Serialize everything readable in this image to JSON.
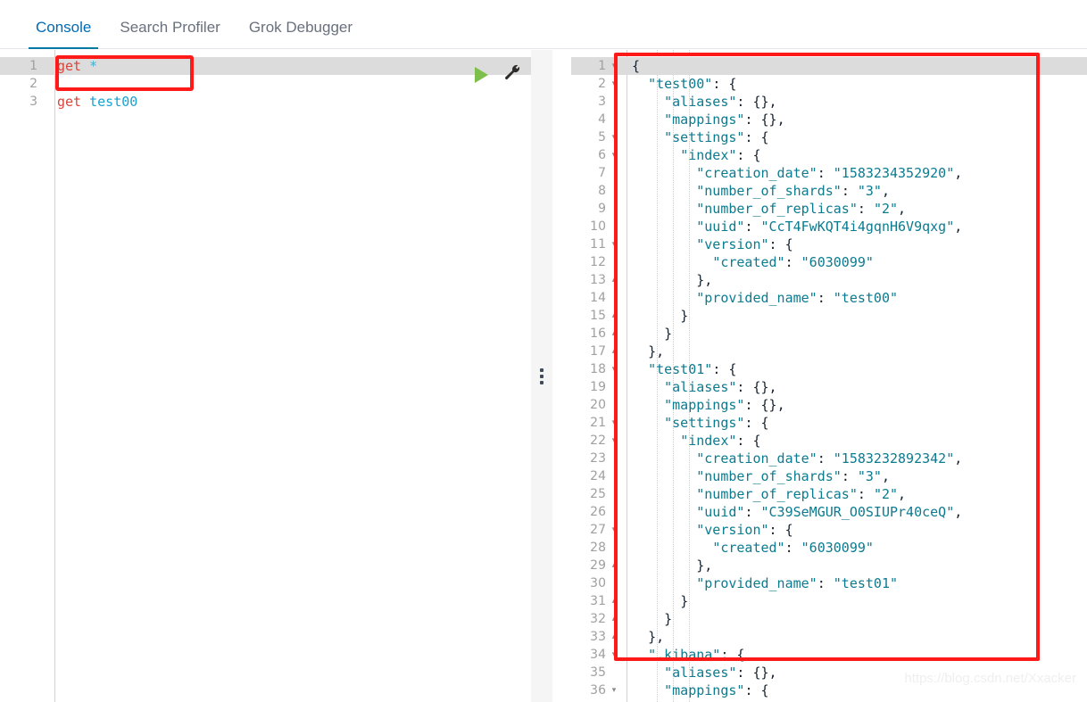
{
  "tabs": [
    {
      "label": "Console",
      "active": true
    },
    {
      "label": "Search Profiler",
      "active": false
    },
    {
      "label": "Grok Debugger",
      "active": false
    }
  ],
  "editor": {
    "error_marker": "error-icon",
    "run_button_label": "play-icon",
    "settings_button_label": "wrench-icon",
    "lines": [
      {
        "num": "1",
        "highlight": true,
        "tokens": [
          {
            "t": "get",
            "c": "kw-get"
          },
          {
            "t": " ",
            "c": ""
          },
          {
            "t": "*",
            "c": "kw-star"
          }
        ]
      },
      {
        "num": "2",
        "highlight": false,
        "tokens": []
      },
      {
        "num": "3",
        "highlight": false,
        "tokens": [
          {
            "t": "get",
            "c": "kw-get"
          },
          {
            "t": " ",
            "c": ""
          },
          {
            "t": "test00",
            "c": "kw-url"
          }
        ]
      }
    ]
  },
  "output": {
    "lines": [
      {
        "num": "1",
        "fold": "▾",
        "highlight": true,
        "text": "{"
      },
      {
        "num": "2",
        "fold": "▾",
        "highlight": false,
        "text": "  \"test00\": {"
      },
      {
        "num": "3",
        "fold": "",
        "highlight": false,
        "text": "    \"aliases\": {},"
      },
      {
        "num": "4",
        "fold": "",
        "highlight": false,
        "text": "    \"mappings\": {},"
      },
      {
        "num": "5",
        "fold": "▾",
        "highlight": false,
        "text": "    \"settings\": {"
      },
      {
        "num": "6",
        "fold": "▾",
        "highlight": false,
        "text": "      \"index\": {"
      },
      {
        "num": "7",
        "fold": "",
        "highlight": false,
        "text": "        \"creation_date\": \"1583234352920\","
      },
      {
        "num": "8",
        "fold": "",
        "highlight": false,
        "text": "        \"number_of_shards\": \"3\","
      },
      {
        "num": "9",
        "fold": "",
        "highlight": false,
        "text": "        \"number_of_replicas\": \"2\","
      },
      {
        "num": "10",
        "fold": "",
        "highlight": false,
        "text": "        \"uuid\": \"CcT4FwKQT4i4gqnH6V9qxg\","
      },
      {
        "num": "11",
        "fold": "▾",
        "highlight": false,
        "text": "        \"version\": {"
      },
      {
        "num": "12",
        "fold": "",
        "highlight": false,
        "text": "          \"created\": \"6030099\""
      },
      {
        "num": "13",
        "fold": "▴",
        "highlight": false,
        "text": "        },"
      },
      {
        "num": "14",
        "fold": "",
        "highlight": false,
        "text": "        \"provided_name\": \"test00\""
      },
      {
        "num": "15",
        "fold": "▴",
        "highlight": false,
        "text": "      }"
      },
      {
        "num": "16",
        "fold": "▴",
        "highlight": false,
        "text": "    }"
      },
      {
        "num": "17",
        "fold": "▴",
        "highlight": false,
        "text": "  },"
      },
      {
        "num": "18",
        "fold": "▾",
        "highlight": false,
        "text": "  \"test01\": {"
      },
      {
        "num": "19",
        "fold": "",
        "highlight": false,
        "text": "    \"aliases\": {},"
      },
      {
        "num": "20",
        "fold": "",
        "highlight": false,
        "text": "    \"mappings\": {},"
      },
      {
        "num": "21",
        "fold": "▾",
        "highlight": false,
        "text": "    \"settings\": {"
      },
      {
        "num": "22",
        "fold": "▾",
        "highlight": false,
        "text": "      \"index\": {"
      },
      {
        "num": "23",
        "fold": "",
        "highlight": false,
        "text": "        \"creation_date\": \"1583232892342\","
      },
      {
        "num": "24",
        "fold": "",
        "highlight": false,
        "text": "        \"number_of_shards\": \"3\","
      },
      {
        "num": "25",
        "fold": "",
        "highlight": false,
        "text": "        \"number_of_replicas\": \"2\","
      },
      {
        "num": "26",
        "fold": "",
        "highlight": false,
        "text": "        \"uuid\": \"C39SeMGUR_O0SIUPr40ceQ\","
      },
      {
        "num": "27",
        "fold": "▾",
        "highlight": false,
        "text": "        \"version\": {"
      },
      {
        "num": "28",
        "fold": "",
        "highlight": false,
        "text": "          \"created\": \"6030099\""
      },
      {
        "num": "29",
        "fold": "▴",
        "highlight": false,
        "text": "        },"
      },
      {
        "num": "30",
        "fold": "",
        "highlight": false,
        "text": "        \"provided_name\": \"test01\""
      },
      {
        "num": "31",
        "fold": "▴",
        "highlight": false,
        "text": "      }"
      },
      {
        "num": "32",
        "fold": "▴",
        "highlight": false,
        "text": "    }"
      },
      {
        "num": "33",
        "fold": "▴",
        "highlight": false,
        "text": "  },"
      },
      {
        "num": "34",
        "fold": "▾",
        "highlight": false,
        "text": "  \".kibana\": {"
      },
      {
        "num": "35",
        "fold": "",
        "highlight": false,
        "text": "    \"aliases\": {},"
      },
      {
        "num": "36",
        "fold": "▾",
        "highlight": false,
        "text": "    \"mappings\": {"
      }
    ]
  },
  "annotations": {
    "editor_highlight_box_color": "#ff1a1a",
    "output_highlight_box_color": "#ff1a1a"
  },
  "watermark": {
    "text": "https://blog.csdn.net/Xxacker"
  },
  "colors": {
    "accent": "#006bb4",
    "json_key": "#0b7b90",
    "run_green": "#7dbf4a",
    "error_red": "#e8443a",
    "annotation_red": "#ff1a1a"
  }
}
